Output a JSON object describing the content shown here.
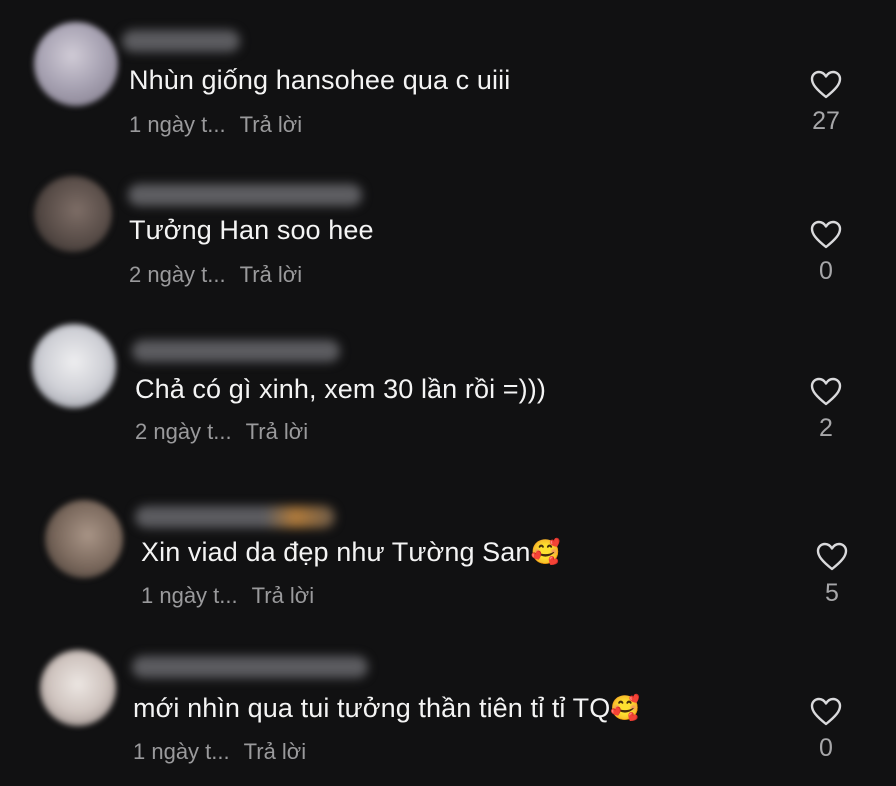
{
  "comments": [
    {
      "text": "Nhùn giống hansohee qua c uiii",
      "emoji": "",
      "time": "1 ngày t...",
      "reply": "Trả lời",
      "likes": "27",
      "avatar_color": "#b8b4c4"
    },
    {
      "text": "Tưởng Han soo hee",
      "emoji": "",
      "time": "2 ngày t...",
      "reply": "Trả lời",
      "likes": "0",
      "avatar_color": "#6a5c55"
    },
    {
      "text": "Chả có gì xinh, xem 30 lần rồi =)))",
      "emoji": "",
      "time": "2 ngày t...",
      "reply": "Trả lời",
      "likes": "2",
      "avatar_color": "#d8d8dc"
    },
    {
      "text": "Xin viad da đẹp như Tường San",
      "emoji": "🥰",
      "time": "1 ngày t...",
      "reply": "Trả lời",
      "likes": "5",
      "avatar_color": "#8a7a6e"
    },
    {
      "text": "mới nhìn qua tui tưởng thần tiên tỉ tỉ TQ",
      "emoji": "🥰",
      "time": "1 ngày t...",
      "reply": "Trả lời",
      "likes": "0",
      "avatar_color": "#d6ccc8"
    }
  ],
  "colors": {
    "background": "#111112",
    "text": "#f4f4f4",
    "meta": "#9a9a9c",
    "like_icon": "#d9d9db"
  }
}
